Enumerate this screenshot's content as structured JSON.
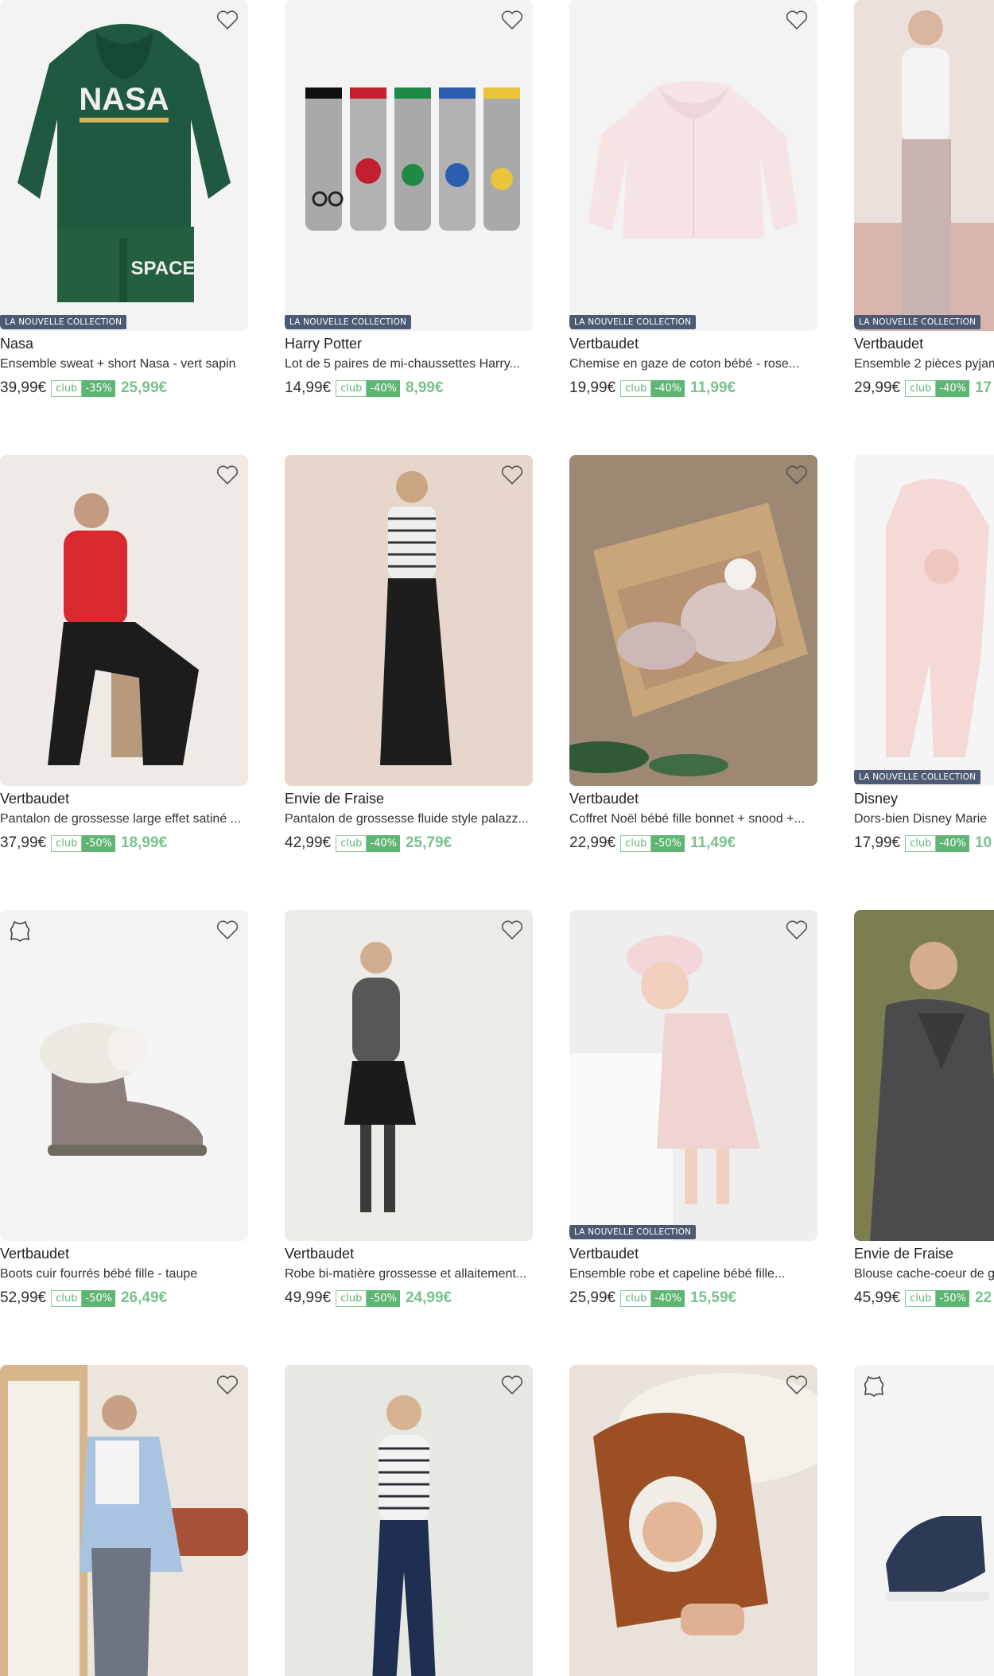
{
  "badge_label": "LA NOUVELLE COLLECTION",
  "club_label": "club",
  "colors": {
    "club_green": "#5fb573",
    "new_price_green": "#79c28d",
    "badge_bg": "#4d5a73"
  },
  "products": [
    {
      "brand": "Nasa",
      "title": "Ensemble sweat + short Nasa - vert sapin",
      "old_price": "39,99€",
      "discount": "-35%",
      "new_price": "25,99€",
      "badge": true,
      "leather": false,
      "icon": "heart-icon"
    },
    {
      "brand": "Harry Potter",
      "title": "Lot de 5 paires de mi-chaussettes Harry...",
      "old_price": "14,99€",
      "discount": "-40%",
      "new_price": "8,99€",
      "badge": true,
      "leather": false,
      "icon": "heart-icon"
    },
    {
      "brand": "Vertbaudet",
      "title": "Chemise en gaze de coton bébé - rose...",
      "old_price": "19,99€",
      "discount": "-40%",
      "new_price": "11,99€",
      "badge": true,
      "leather": false,
      "icon": "heart-icon"
    },
    {
      "brand": "Vertbaudet",
      "title": "Ensemble 2 pièces pyjam",
      "old_price": "29,99€",
      "discount": "-40%",
      "new_price": "17",
      "badge": true,
      "leather": false,
      "icon": "heart-icon"
    },
    {
      "brand": "Vertbaudet",
      "title": "Pantalon de grossesse large effet satiné ...",
      "old_price": "37,99€",
      "discount": "-50%",
      "new_price": "18,99€",
      "badge": false,
      "leather": false,
      "icon": "heart-icon"
    },
    {
      "brand": "Envie de Fraise",
      "title": "Pantalon de grossesse fluide style palazz...",
      "old_price": "42,99€",
      "discount": "-40%",
      "new_price": "25,79€",
      "badge": false,
      "leather": false,
      "icon": "heart-icon"
    },
    {
      "brand": "Vertbaudet",
      "title": "Coffret Noël bébé fille bonnet + snood +...",
      "old_price": "22,99€",
      "discount": "-50%",
      "new_price": "11,49€",
      "badge": false,
      "leather": false,
      "icon": "heart-icon"
    },
    {
      "brand": "Disney",
      "title": "Dors-bien Disney Marie",
      "old_price": "17,99€",
      "discount": "-40%",
      "new_price": "10",
      "badge": true,
      "leather": false,
      "icon": "heart-icon"
    },
    {
      "brand": "Vertbaudet",
      "title": "Boots cuir fourrés bébé fille - taupe",
      "old_price": "52,99€",
      "discount": "-50%",
      "new_price": "26,49€",
      "badge": false,
      "leather": true,
      "icon": "heart-icon"
    },
    {
      "brand": "Vertbaudet",
      "title": "Robe bi-matière grossesse et allaitement...",
      "old_price": "49,99€",
      "discount": "-50%",
      "new_price": "24,99€",
      "badge": false,
      "leather": false,
      "icon": "heart-icon"
    },
    {
      "brand": "Vertbaudet",
      "title": "Ensemble robe et capeline bébé fille...",
      "old_price": "25,99€",
      "discount": "-40%",
      "new_price": "15,59€",
      "badge": true,
      "leather": false,
      "icon": "heart-icon"
    },
    {
      "brand": "Envie de Fraise",
      "title": "Blouse cache-coeur de g",
      "old_price": "45,99€",
      "discount": "-50%",
      "new_price": "22",
      "badge": false,
      "leather": false,
      "icon": "heart-icon"
    },
    {
      "brand": "",
      "title": "",
      "old_price": "",
      "discount": "",
      "new_price": "",
      "badge": false,
      "leather": false,
      "icon": "heart-icon"
    },
    {
      "brand": "",
      "title": "",
      "old_price": "",
      "discount": "",
      "new_price": "",
      "badge": false,
      "leather": false,
      "icon": "heart-icon"
    },
    {
      "brand": "",
      "title": "",
      "old_price": "",
      "discount": "",
      "new_price": "",
      "badge": false,
      "leather": false,
      "icon": "heart-icon"
    },
    {
      "brand": "",
      "title": "",
      "old_price": "",
      "discount": "",
      "new_price": "",
      "badge": false,
      "leather": true,
      "icon": "heart-icon"
    }
  ]
}
